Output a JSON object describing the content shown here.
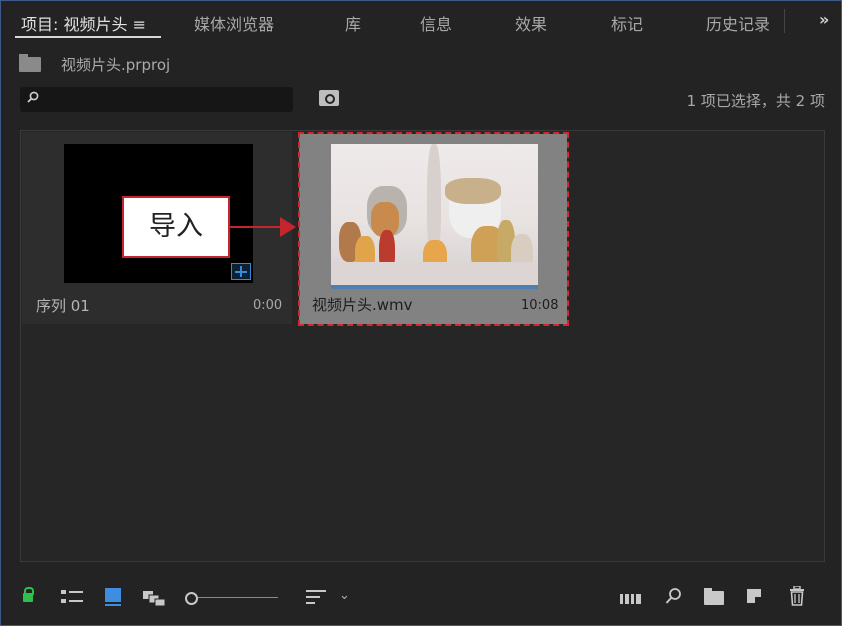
{
  "tabs": [
    {
      "label": "项目: 视频片头",
      "active": true
    },
    {
      "label": "媒体浏览器"
    },
    {
      "label": "库"
    },
    {
      "label": "信息"
    },
    {
      "label": "效果"
    },
    {
      "label": "标记"
    },
    {
      "label": "历史记录"
    }
  ],
  "tab_menu_glyph": "≡",
  "overflow_glyph": "»",
  "path": {
    "label": "视频片头.prproj",
    "icon": "folder-up-icon"
  },
  "search": {
    "value": "",
    "placeholder": ""
  },
  "selection_status": "1 项已选择，共 2 项",
  "items": [
    {
      "name": "序列 01",
      "duration": "0:00",
      "type": "sequence"
    },
    {
      "name": "视频片头.wmv",
      "duration": "10:08",
      "type": "video",
      "selected": true
    }
  ],
  "callout": {
    "label": "导入"
  },
  "colors": {
    "accent": "#3d8ee0",
    "annotation": "#d22630",
    "lock": "#2fc04b",
    "panel": "#232323"
  }
}
